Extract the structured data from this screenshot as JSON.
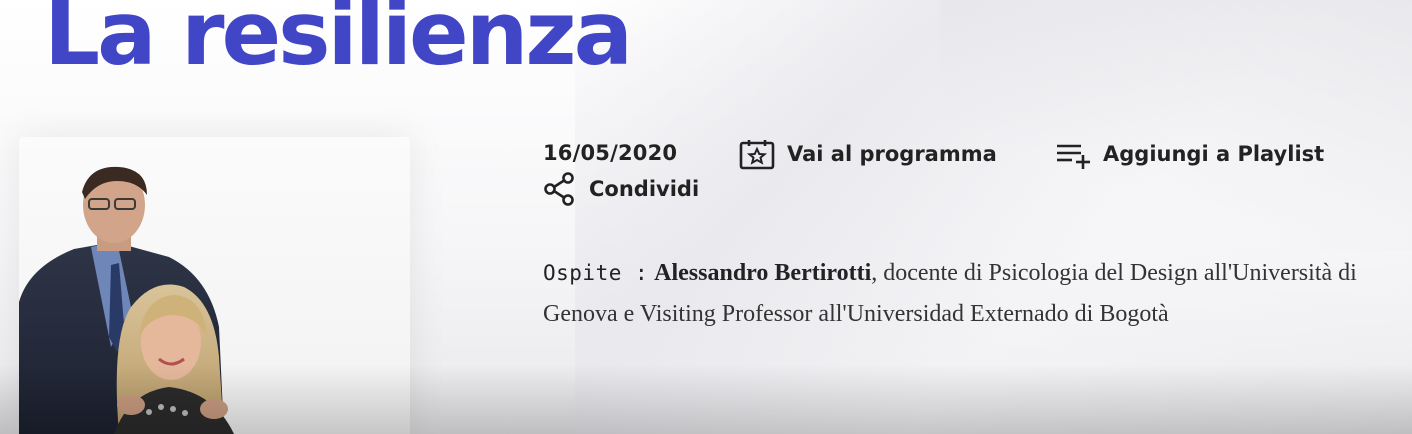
{
  "page": {
    "title": "La resilienza",
    "date": "16/05/2020",
    "actions": {
      "program": "Vai al programma",
      "playlist": "Aggiungi a Playlist",
      "share": "Condividi"
    },
    "description": {
      "guest_label": "Ospite :",
      "guest_name": "Alessandro Bertirotti",
      "guest_info": ", docente di Psicologia del Design all'Università di Genova e Visiting Professor all'Universidad Externado di Bogotà"
    },
    "colors": {
      "title": "#4146c6",
      "text": "#222222"
    },
    "icons": {
      "program": "calendar-star-icon",
      "playlist": "playlist-add-icon",
      "share": "share-icon"
    },
    "thumbnail": {
      "subject": "two presenters portrait"
    }
  }
}
